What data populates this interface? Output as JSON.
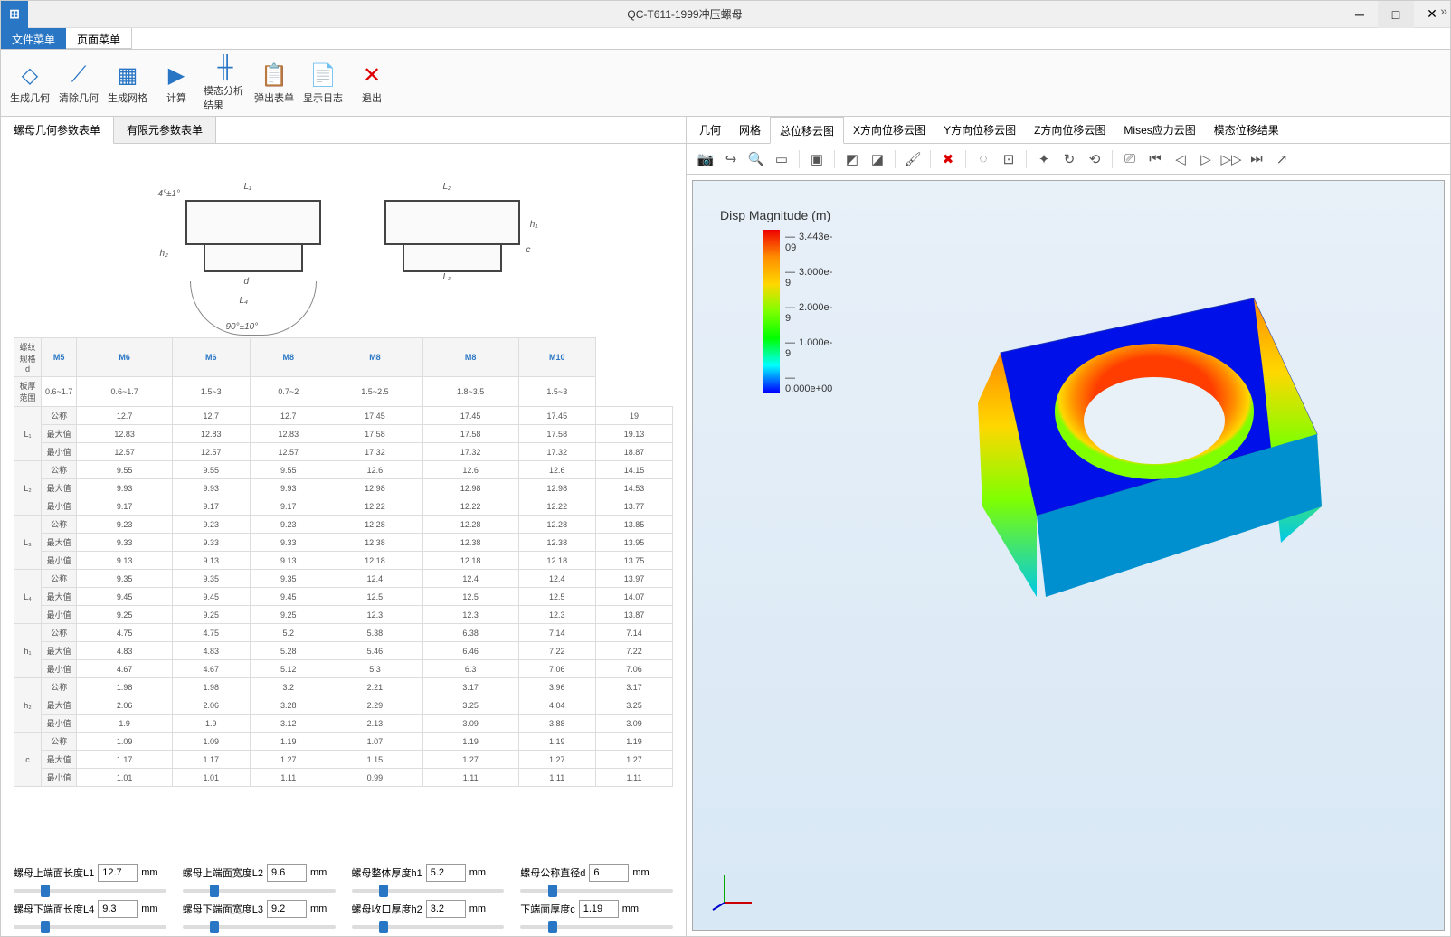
{
  "window": {
    "title": "QC-T611-1999冲压螺母",
    "app_icon": "⊞"
  },
  "menu": {
    "tab1": "文件菜单",
    "tab2": "页面菜单"
  },
  "ribbon": [
    {
      "icon": "◇",
      "label": "生成几何",
      "color": "#2976c4"
    },
    {
      "icon": "⟋",
      "label": "清除几何",
      "color": "#2976c4"
    },
    {
      "icon": "▦",
      "label": "生成网格",
      "color": "#2976c4"
    },
    {
      "icon": "▶",
      "label": "计算",
      "color": "#2976c4"
    },
    {
      "icon": "╫",
      "label": "模态分析结果",
      "color": "#2976c4"
    },
    {
      "icon": "📋",
      "label": "弹出表单",
      "color": "#2976c4"
    },
    {
      "icon": "📄",
      "label": "显示日志",
      "color": "#2976c4"
    },
    {
      "icon": "✕",
      "label": "退出",
      "color": "#d00"
    }
  ],
  "left_tabs": {
    "tab1": "螺母几何参数表单",
    "tab2": "有限元参数表单"
  },
  "diagram_labels": {
    "angle1": "4°±1°",
    "angle2": "90°±10°",
    "L1": "L₁",
    "L2": "L₂",
    "L3": "L₃",
    "L4": "L₄",
    "h1": "h₁",
    "h2": "h₂",
    "d": "d",
    "c": "c"
  },
  "spec_table": {
    "col_head": [
      "螺纹规格\nd",
      "M5",
      "M6",
      "M6",
      "M8",
      "M8",
      "M8",
      "M10"
    ],
    "thickness_row": [
      "板厚范围",
      "0.6~1.7",
      "0.6~1.7",
      "1.5~3",
      "0.7~2",
      "1.5~2.5",
      "1.8~3.5",
      "1.5~3"
    ],
    "groups": [
      {
        "name": "L₁",
        "rows": [
          [
            "公称",
            "12.7",
            "12.7",
            "12.7",
            "17.45",
            "17.45",
            "17.45",
            "19"
          ],
          [
            "最大值",
            "12.83",
            "12.83",
            "12.83",
            "17.58",
            "17.58",
            "17.58",
            "19.13"
          ],
          [
            "最小值",
            "12.57",
            "12.57",
            "12.57",
            "17.32",
            "17.32",
            "17.32",
            "18.87"
          ]
        ]
      },
      {
        "name": "L₂",
        "rows": [
          [
            "公称",
            "9.55",
            "9.55",
            "9.55",
            "12.6",
            "12.6",
            "12.6",
            "14.15"
          ],
          [
            "最大值",
            "9.93",
            "9.93",
            "9.93",
            "12.98",
            "12.98",
            "12.98",
            "14.53"
          ],
          [
            "最小值",
            "9.17",
            "9.17",
            "9.17",
            "12.22",
            "12.22",
            "12.22",
            "13.77"
          ]
        ]
      },
      {
        "name": "L₃",
        "rows": [
          [
            "公称",
            "9.23",
            "9.23",
            "9.23",
            "12.28",
            "12.28",
            "12.28",
            "13.85"
          ],
          [
            "最大值",
            "9.33",
            "9.33",
            "9.33",
            "12.38",
            "12.38",
            "12.38",
            "13.95"
          ],
          [
            "最小值",
            "9.13",
            "9.13",
            "9.13",
            "12.18",
            "12.18",
            "12.18",
            "13.75"
          ]
        ]
      },
      {
        "name": "L₄",
        "rows": [
          [
            "公称",
            "9.35",
            "9.35",
            "9.35",
            "12.4",
            "12.4",
            "12.4",
            "13.97"
          ],
          [
            "最大值",
            "9.45",
            "9.45",
            "9.45",
            "12.5",
            "12.5",
            "12.5",
            "14.07"
          ],
          [
            "最小值",
            "9.25",
            "9.25",
            "9.25",
            "12.3",
            "12.3",
            "12.3",
            "13.87"
          ]
        ]
      },
      {
        "name": "h₁",
        "rows": [
          [
            "公称",
            "4.75",
            "4.75",
            "5.2",
            "5.38",
            "6.38",
            "7.14",
            "7.14"
          ],
          [
            "最大值",
            "4.83",
            "4.83",
            "5.28",
            "5.46",
            "6.46",
            "7.22",
            "7.22"
          ],
          [
            "最小值",
            "4.67",
            "4.67",
            "5.12",
            "5.3",
            "6.3",
            "7.06",
            "7.06"
          ]
        ]
      },
      {
        "name": "h₂",
        "rows": [
          [
            "公称",
            "1.98",
            "1.98",
            "3.2",
            "2.21",
            "3.17",
            "3.96",
            "3.17"
          ],
          [
            "最大值",
            "2.06",
            "2.06",
            "3.28",
            "2.29",
            "3.25",
            "4.04",
            "3.25"
          ],
          [
            "最小值",
            "1.9",
            "1.9",
            "3.12",
            "2.13",
            "3.09",
            "3.88",
            "3.09"
          ]
        ]
      },
      {
        "name": "c",
        "rows": [
          [
            "公称",
            "1.09",
            "1.09",
            "1.19",
            "1.07",
            "1.19",
            "1.19",
            "1.19"
          ],
          [
            "最大值",
            "1.17",
            "1.17",
            "1.27",
            "1.15",
            "1.27",
            "1.27",
            "1.27"
          ],
          [
            "最小值",
            "1.01",
            "1.01",
            "1.11",
            "0.99",
            "1.11",
            "1.11",
            "1.11"
          ]
        ]
      }
    ]
  },
  "params": [
    {
      "label": "螺母上端面长度L1",
      "value": "12.7",
      "unit": "mm"
    },
    {
      "label": "螺母上端面宽度L2",
      "value": "9.6",
      "unit": "mm"
    },
    {
      "label": "螺母整体厚度h1",
      "value": "5.2",
      "unit": "mm"
    },
    {
      "label": "螺母公称直径d",
      "value": "6",
      "unit": "mm"
    },
    {
      "label": "螺母下端面长度L4",
      "value": "9.3",
      "unit": "mm"
    },
    {
      "label": "螺母下端面宽度L3",
      "value": "9.2",
      "unit": "mm"
    },
    {
      "label": "螺母收口厚度h2",
      "value": "3.2",
      "unit": "mm"
    },
    {
      "label": "下端面厚度c",
      "value": "1.19",
      "unit": "mm"
    }
  ],
  "right_tabs": [
    "几何",
    "网格",
    "总位移云图",
    "X方向位移云图",
    "Y方向位移云图",
    "Z方向位移云图",
    "Mises应力云图",
    "模态位移结果"
  ],
  "legend": {
    "title": "Disp Magnitude (m)",
    "ticks": [
      "3.443e-09",
      "3.000e-9",
      "2.000e-9",
      "1.000e-9",
      "0.000e+00"
    ]
  }
}
